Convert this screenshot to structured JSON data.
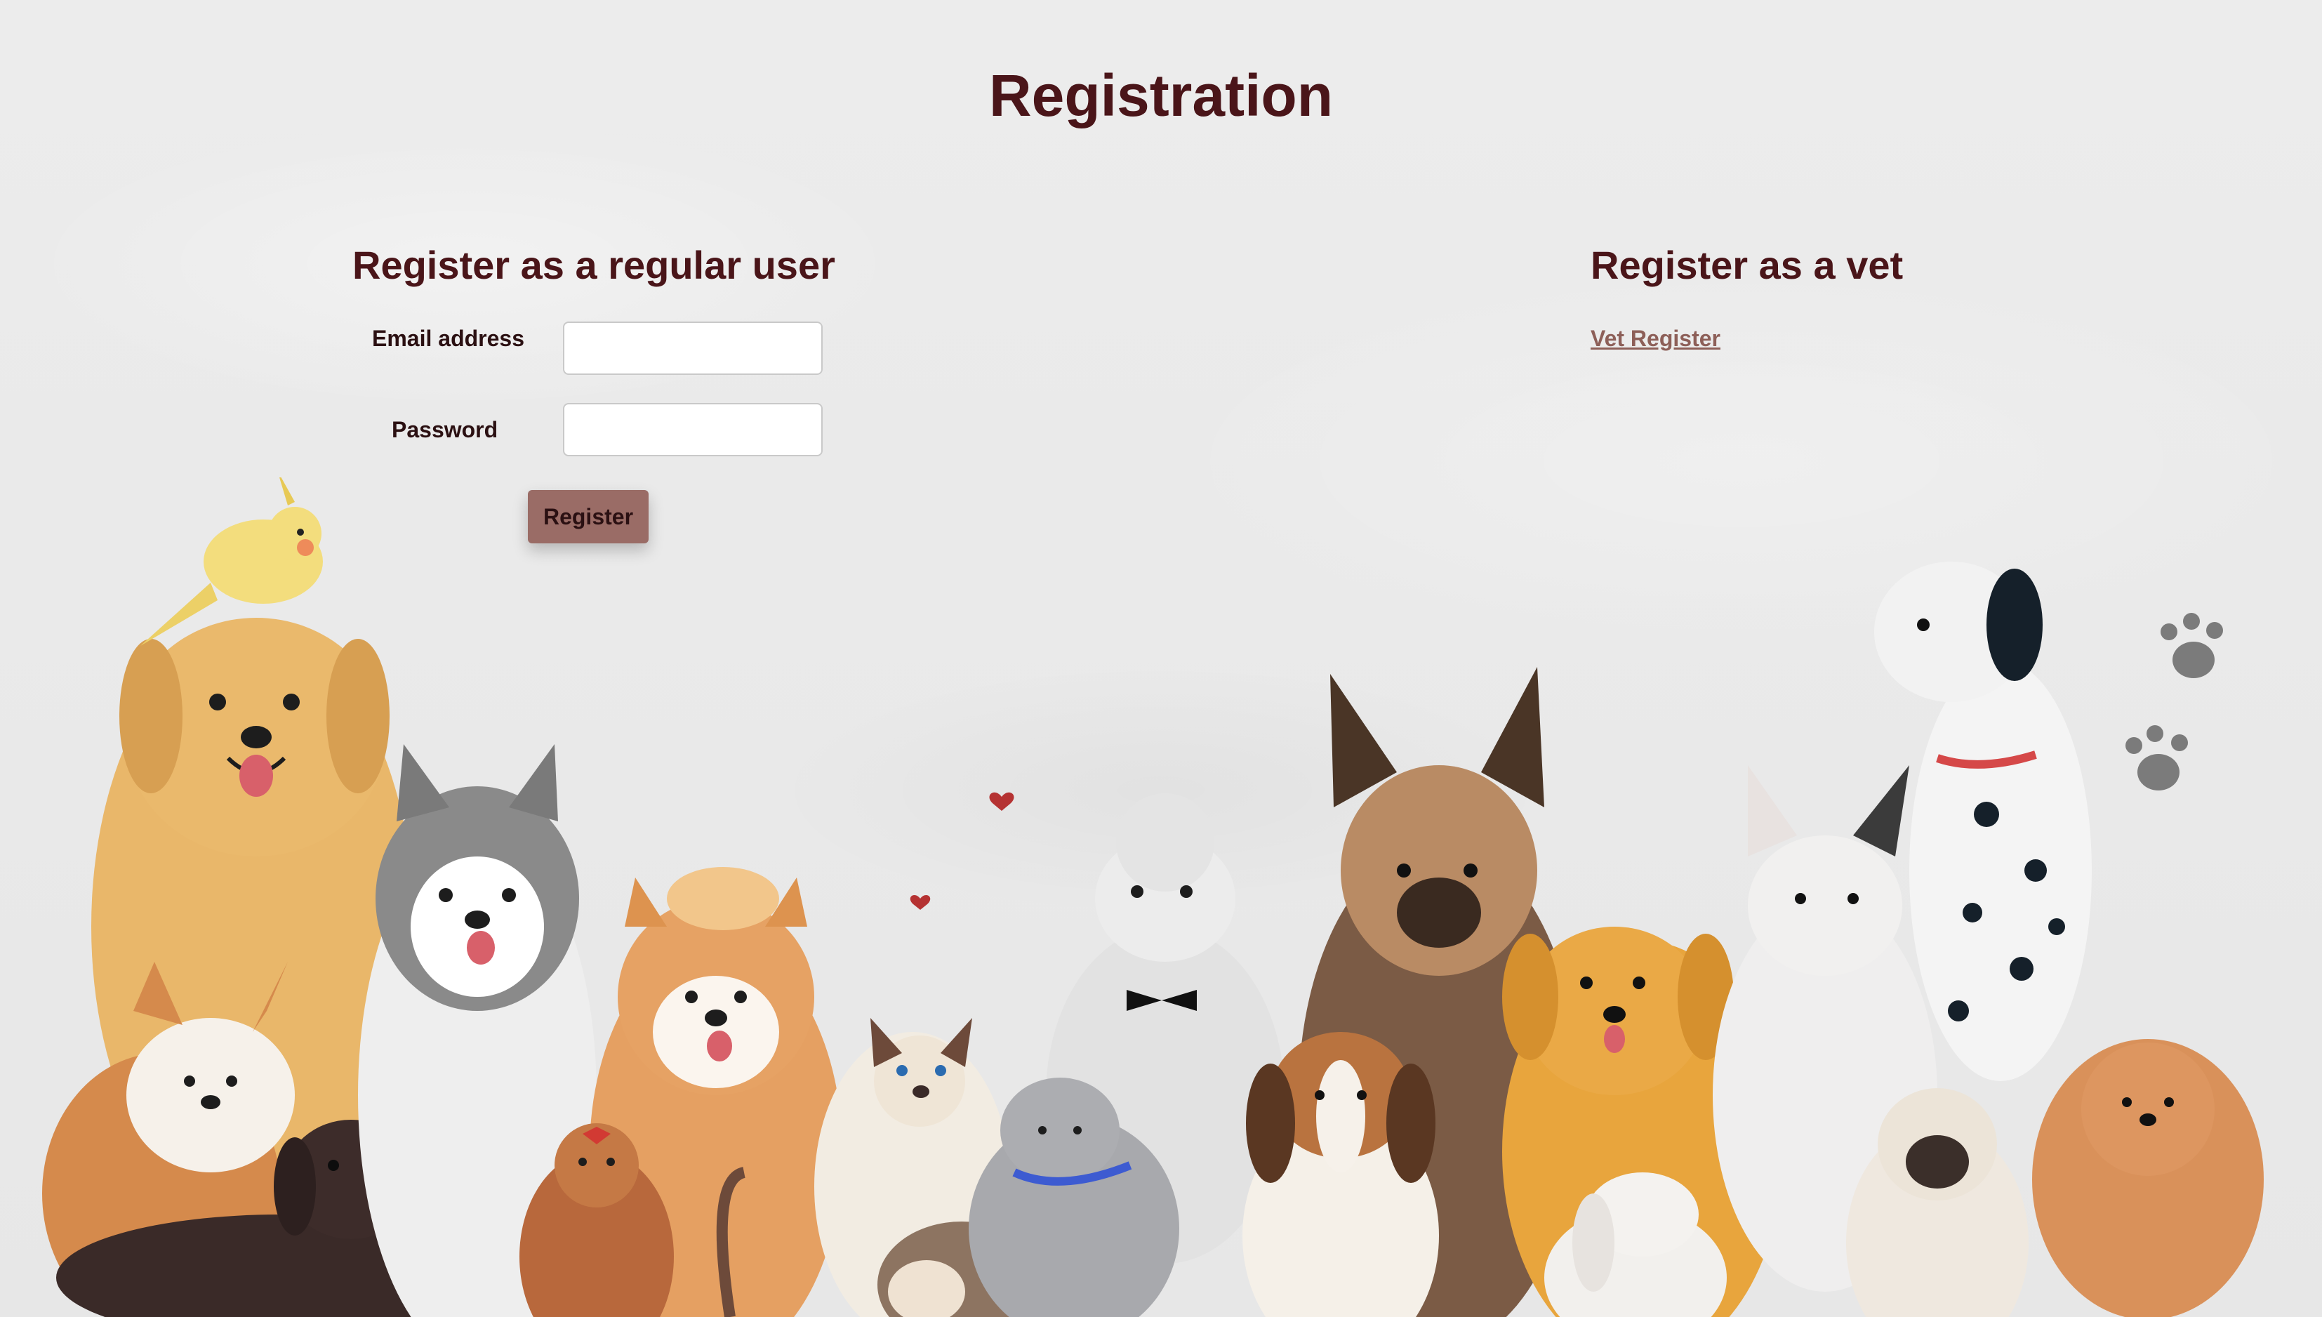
{
  "page": {
    "title": "Registration"
  },
  "regular_user": {
    "heading": "Register as a regular user",
    "email_label": "Email address",
    "email_value": "",
    "password_label": "Password",
    "password_value": "",
    "register_button": "Register"
  },
  "vet": {
    "heading": "Register as a vet",
    "link_label": "Vet Register"
  },
  "illustration": {
    "description_icon": "pets-group-illustration"
  },
  "colors": {
    "heading": "#4a1519",
    "button": "#9a6c66",
    "link": "#8d5f58",
    "background": "#ebebeb"
  }
}
